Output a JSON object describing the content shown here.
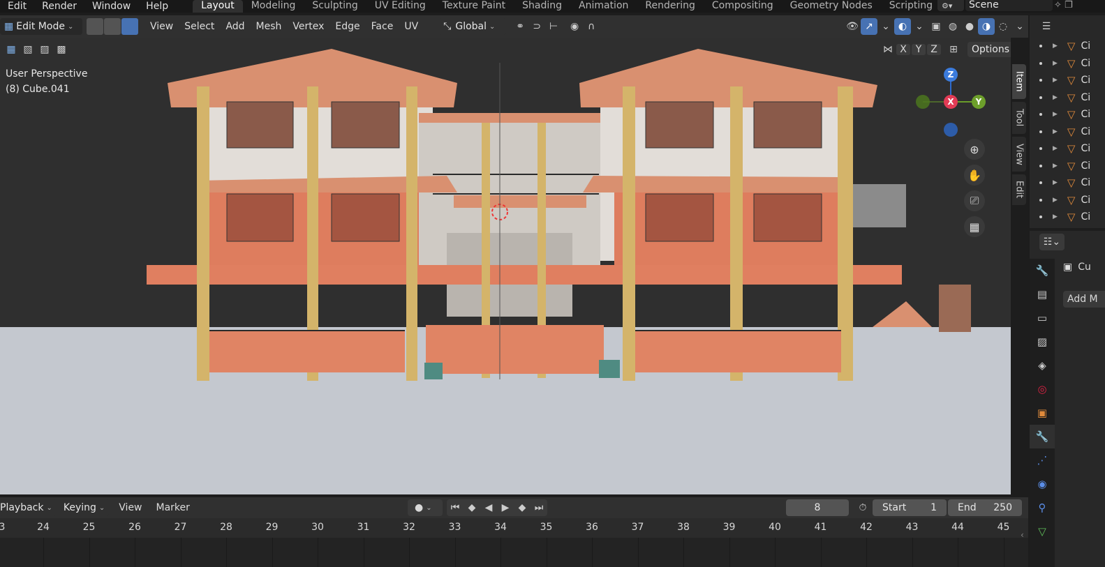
{
  "topbar": {
    "menus": [
      "Edit",
      "Render",
      "Window",
      "Help"
    ],
    "workspaces": [
      "Layout",
      "Modeling",
      "Sculpting",
      "UV Editing",
      "Texture Paint",
      "Shading",
      "Animation",
      "Rendering",
      "Compositing",
      "Geometry Nodes",
      "Scripting"
    ],
    "active_workspace": "Layout",
    "add_tab": "+",
    "scene_label": "Scene"
  },
  "header": {
    "mode": "Edit Mode",
    "menus": [
      "View",
      "Select",
      "Add",
      "Mesh",
      "Vertex",
      "Edge",
      "Face",
      "UV"
    ],
    "transform_orientation": "Global",
    "options_label": "Options",
    "axis_x": "X",
    "axis_y": "Y",
    "axis_z": "Z"
  },
  "viewport": {
    "view_name": "User Perspective",
    "object_info": "(8) Cube.041",
    "gizmo_axes": {
      "x": "X",
      "y": "Y",
      "z": "Z"
    }
  },
  "npanel_tabs": [
    "Item",
    "Tool",
    "View",
    "Edit"
  ],
  "outliner": {
    "rows": [
      "Ci",
      "Ci",
      "Ci",
      "Ci",
      "Ci",
      "Ci",
      "Ci",
      "Ci",
      "Ci",
      "Ci",
      "Ci"
    ]
  },
  "properties": {
    "object_name": "Cu",
    "add_modifier": "Add M"
  },
  "timeline": {
    "menus": [
      "Playback",
      "Keying",
      "View",
      "Marker"
    ],
    "current_frame": "8",
    "start_label": "Start",
    "start_value": "1",
    "end_label": "End",
    "end_value": "250",
    "ruler": [
      "3",
      "24",
      "25",
      "26",
      "27",
      "28",
      "29",
      "30",
      "31",
      "32",
      "33",
      "34",
      "35",
      "36",
      "37",
      "38",
      "39",
      "40",
      "41",
      "42",
      "43",
      "44",
      "45"
    ]
  },
  "colors": {
    "accent": "#4772b3",
    "roof": "#d88f6e",
    "wall": "#d9d4cf",
    "orange": "#de7d5e",
    "column": "#d4b46a",
    "ground": "#c4c8cf"
  }
}
